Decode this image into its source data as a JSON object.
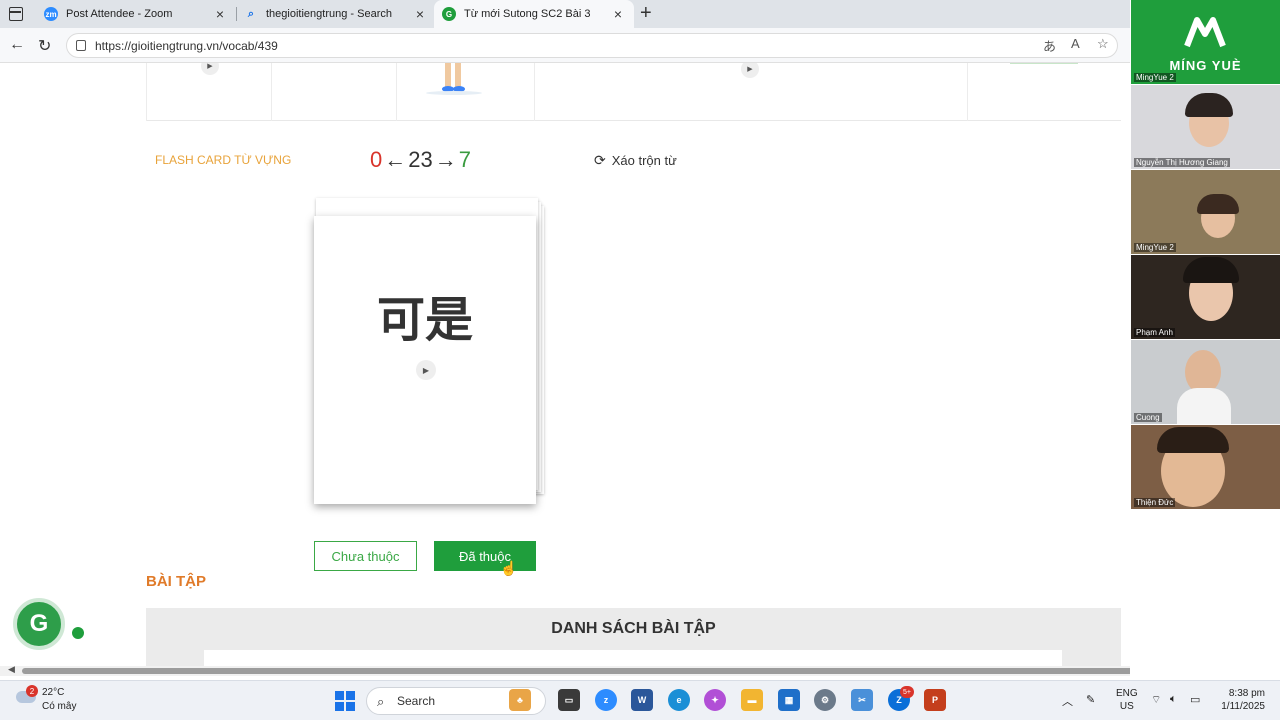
{
  "browser": {
    "tabs": [
      {
        "title": "Post Attendee - Zoom",
        "favicon": "zm"
      },
      {
        "title": "thegioitiengtrung - Search",
        "favicon": "search"
      },
      {
        "title": "Từ mới Sutong SC2 Bài 3",
        "favicon": "G"
      }
    ],
    "url": "https://gioitiengtrung.vn/vocab/439"
  },
  "flashcard": {
    "section_label": "FLASH CARD TỪ VỰNG",
    "count_left": "0",
    "arrow_left": "←",
    "count_total": "23",
    "arrow_right": "→",
    "count_right": "7",
    "shuffle_label": "Xáo trộn từ",
    "card_word": "可是",
    "not_learned_label": "Chưa thuộc",
    "learned_label": "Đã thuộc"
  },
  "exercises": {
    "heading": "BÀI TẬP",
    "list_title": "DANH SÁCH BÀI TẬP"
  },
  "zoom": {
    "logo_text": "MÍNG YUÈ",
    "participants": [
      "MingYue 2",
      "Nguyễn Thị Hương Giang",
      "MingYue 2",
      "Phạm Anh",
      "Cuong",
      "Thiện Đức"
    ]
  },
  "taskbar": {
    "weather_temp": "22°C",
    "weather_cond": "Có mây",
    "weather_badge": "2",
    "search_label": "Search",
    "notif_badge": "5+",
    "lang_line1": "ENG",
    "lang_line2": "US",
    "time": "8:38 pm",
    "date": "1/11/2025"
  },
  "colors": {
    "brand_green": "#1f9e3c",
    "accent_orange": "#e07b2a",
    "counter_red": "#d9342b"
  }
}
